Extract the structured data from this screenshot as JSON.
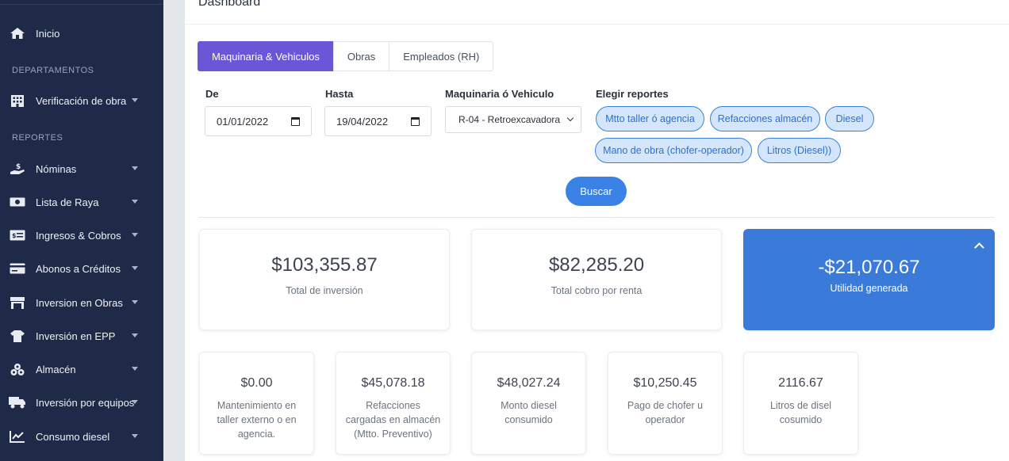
{
  "sidebar": {
    "inicio": "Inicio",
    "departamentos_header": "DEPARTAMENTOS",
    "verificacion": "Verificación de obra",
    "reportes_header": "REPORTES",
    "items": [
      {
        "label": "Nóminas",
        "icon": "hand-money-icon"
      },
      {
        "label": "Lista de Raya",
        "icon": "money-bill-icon"
      },
      {
        "label": "Ingresos & Cobros",
        "icon": "money-check-icon"
      },
      {
        "label": "Abonos a Créditos",
        "icon": "credit-card-icon"
      },
      {
        "label": "Inversion en Obras",
        "icon": "store-icon"
      },
      {
        "label": "Inversión en EPP",
        "icon": "tshirt-icon"
      },
      {
        "label": "Almacén",
        "icon": "boxes-icon"
      },
      {
        "label": "Inversión por equipos",
        "icon": "truck-icon"
      },
      {
        "label": "Consumo diesel",
        "icon": "chart-line-icon"
      }
    ]
  },
  "main": {
    "title": "Dashboard",
    "tabs": [
      {
        "label": "Maquinaria & Vehiculos",
        "active": true
      },
      {
        "label": "Obras",
        "active": false
      },
      {
        "label": "Empleados (RH)",
        "active": false
      }
    ],
    "filters": {
      "de_label": "De",
      "de_value": "01/01/2022",
      "hasta_label": "Hasta",
      "hasta_value": "19/04/2022",
      "maquinaria_label": "Maquinaria ó Vehiculo",
      "maquinaria_value": "R-04 - Retroexcavadora",
      "reportes_label": "Elegir reportes"
    },
    "report_pills": [
      "Mtto taller ó agencia",
      "Refacciones almacén",
      "Diesel",
      "Mano de obra (chofer-operador)",
      "Litros (Diesel))"
    ],
    "search_button": "Buscar",
    "summary": [
      {
        "value": "$103,355.87",
        "caption": "Total de inversión"
      },
      {
        "value": "$82,285.20",
        "caption": "Total cobro por renta"
      },
      {
        "value": "-$21,070.67",
        "caption": "Utilidad generada"
      }
    ],
    "details": [
      {
        "value": "$0.00",
        "caption": "Mantenimiento en taller externo o en agencia."
      },
      {
        "value": "$45,078.18",
        "caption": "Refacciones cargadas en almacén (Mtto. Preventivo)"
      },
      {
        "value": "$48,027.24",
        "caption": "Monto diesel consumido"
      },
      {
        "value": "$10,250.45",
        "caption": "Pago de chofer u operador"
      },
      {
        "value": "2116.67",
        "caption": "Litros de disel cosumido"
      }
    ]
  },
  "colors": {
    "sidebar_bg": "#1e2a47",
    "active_tab": "#6a56d6",
    "accent_blue": "#3b82e6",
    "pill_bg": "#d4e6fb"
  }
}
